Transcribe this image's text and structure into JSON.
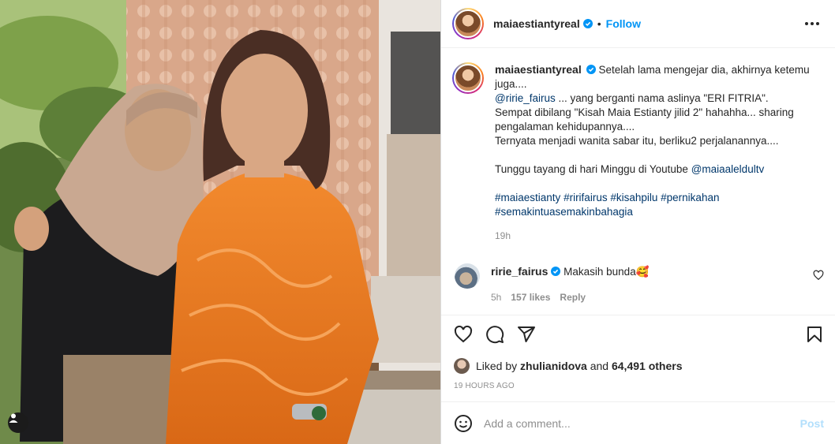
{
  "post": {
    "username": "maiaestiantyreal",
    "follow_label": "Follow",
    "separator": "•",
    "caption_line1": "Setelah lama mengejar dia, akhirnya ketemu juga....",
    "mention1": "@ririe_fairus",
    "caption_line2": " ... yang berganti nama aslinya \"ERI FITRIA\".",
    "caption_line3": "Sempat dibilang \"Kisah Maia Estianty jilid 2\" hahahha... sharing pengalaman kehidupannya....",
    "caption_line4": "Ternyata menjadi wanita sabar itu, berliku2 perjalanannya....",
    "caption_line5": "Tunggu tayang di hari Minggu di Youtube ",
    "mention2": "@maiaaleldultv",
    "hashtags": [
      "#maiaestianty",
      "#ririfairus",
      "#kisahpilu",
      "#pernikahan",
      "#semakintuasemakinbahagia"
    ],
    "age": "19h"
  },
  "comment": {
    "username": "ririe_fairus",
    "text": "Makasih bunda🥰",
    "age": "5h",
    "likes": "157 likes",
    "reply_label": "Reply"
  },
  "likes_summary": {
    "prefix": "Liked by ",
    "user": "zhulianidova",
    "middle": " and ",
    "count": "64,491 others"
  },
  "timestamp": "19 HOURS AGO",
  "add_comment": {
    "placeholder": "Add a comment...",
    "post_label": "Post"
  },
  "colors": {
    "accent": "#0095f6",
    "link": "#00376b",
    "muted": "#8e8e8e",
    "post_disabled": "#b2dffc"
  },
  "icons": {
    "like": "heart-icon",
    "comment": "comment-icon",
    "share": "share-icon",
    "save": "bookmark-icon",
    "emoji": "emoji-icon",
    "more": "more-options-icon",
    "verified": "verified-badge-icon",
    "tags": "user-tag-icon"
  }
}
